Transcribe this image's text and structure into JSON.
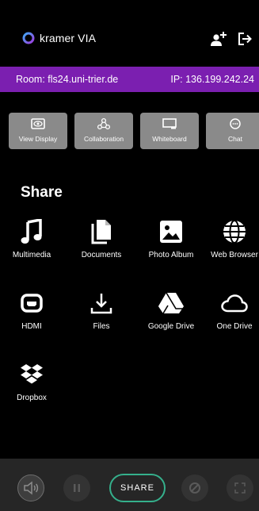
{
  "header": {
    "brand": "kramer",
    "brand_via": "VIA",
    "icons": {
      "add_user": "add-user-icon",
      "logout": "logout-icon"
    }
  },
  "room_bar": {
    "room": "Room: fls24.uni-trier.de",
    "ip": "IP: 136.199.242.24",
    "color": "#7b1fb0"
  },
  "modes": [
    {
      "label": "View Display",
      "icon": "eye-icon"
    },
    {
      "label": "Collaboration",
      "icon": "collaboration-icon"
    },
    {
      "label": "Whiteboard",
      "icon": "whiteboard-icon"
    },
    {
      "label": "Chat",
      "icon": "chat-icon"
    }
  ],
  "share": {
    "title": "Share",
    "items": [
      {
        "label": "Multimedia",
        "icon": "music-note-icon"
      },
      {
        "label": "Documents",
        "icon": "documents-icon"
      },
      {
        "label": "Photo Album",
        "icon": "photo-icon"
      },
      {
        "label": "Web Browser",
        "icon": "globe-icon"
      },
      {
        "label": "HDMI",
        "icon": "hdmi-icon"
      },
      {
        "label": "Files",
        "icon": "download-icon"
      },
      {
        "label": "Google Drive",
        "icon": "google-drive-icon"
      },
      {
        "label": "One Drive",
        "icon": "cloud-icon"
      },
      {
        "label": "Dropbox",
        "icon": "dropbox-icon"
      }
    ]
  },
  "bottom_bar": {
    "share_label": "SHARE",
    "accent": "#35b08c"
  }
}
